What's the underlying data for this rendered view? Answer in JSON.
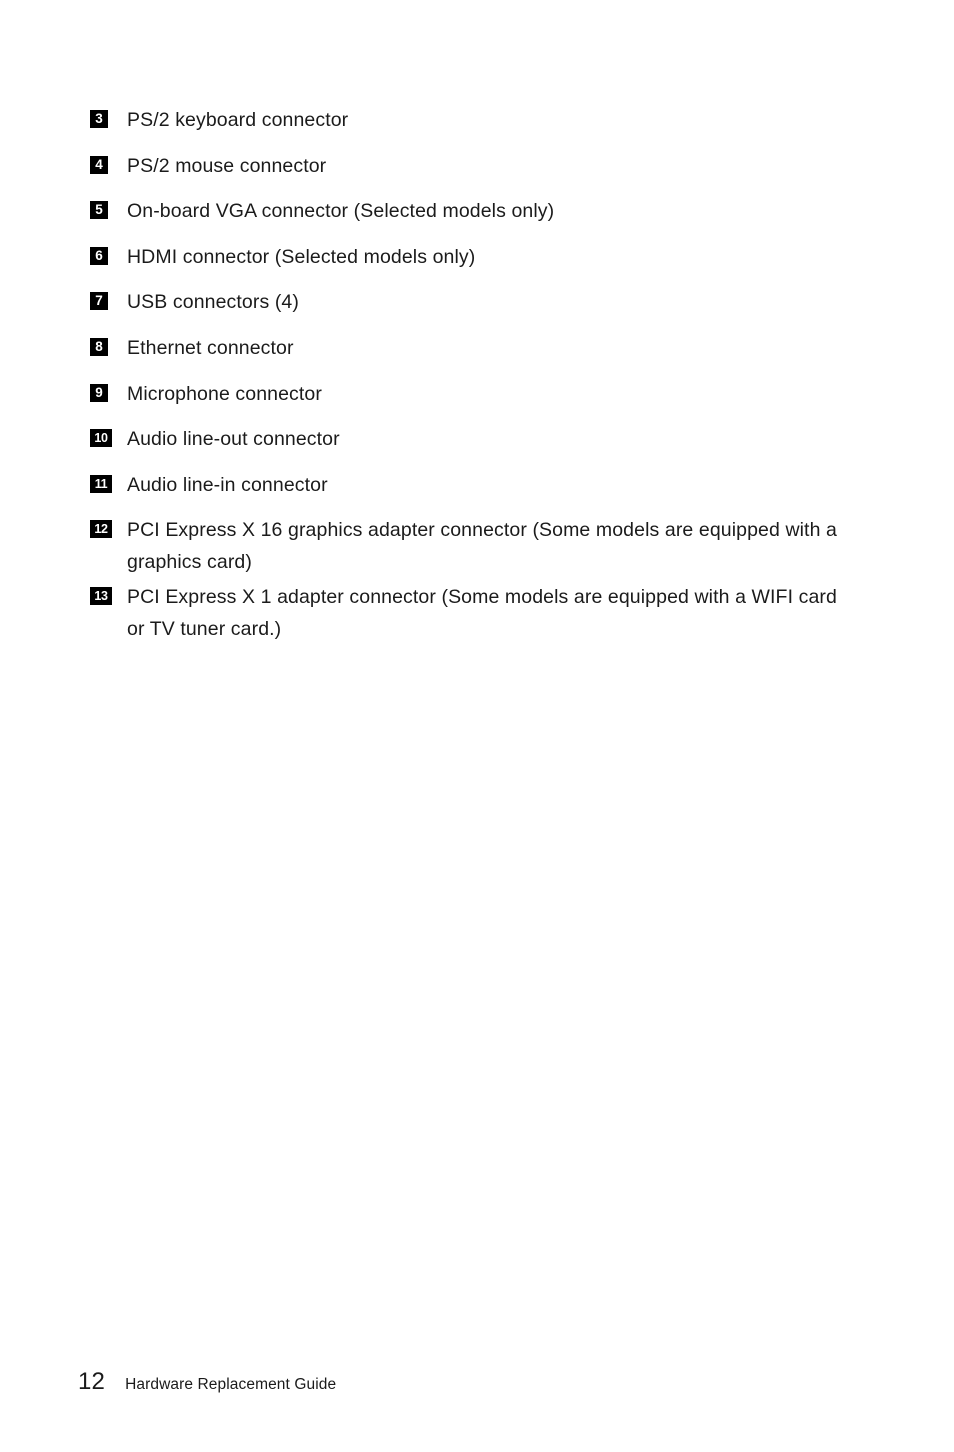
{
  "document": {
    "background_color": "#ffffff",
    "text_color": "#1b1b1b",
    "badge_background_color": "#000000",
    "badge_text_color": "#ffffff"
  },
  "connector_list": [
    {
      "number": "3",
      "label": "PS/2 keyboard connector"
    },
    {
      "number": "4",
      "label": "PS/2 mouse connector"
    },
    {
      "number": "5",
      "label": "On-board VGA connector (Selected models only)"
    },
    {
      "number": "6",
      "label": "HDMI connector (Selected models only)"
    },
    {
      "number": "7",
      "label": "USB connectors (4)"
    },
    {
      "number": "8",
      "label": "Ethernet connector"
    },
    {
      "number": "9",
      "label": "Microphone connector"
    },
    {
      "number": "10",
      "label": "Audio line-out connector"
    },
    {
      "number": "11",
      "label": "Audio line-in connector"
    },
    {
      "number": "12",
      "label": "PCI Express X 16 graphics adapter connector (Some models are equipped with a graphics card)"
    },
    {
      "number": "13",
      "label": "PCI Express X 1 adapter connector (Some models are equipped with a WIFI card or TV tuner card.)"
    }
  ],
  "footer": {
    "page_number": "12",
    "title": "Hardware Replacement Guide"
  }
}
